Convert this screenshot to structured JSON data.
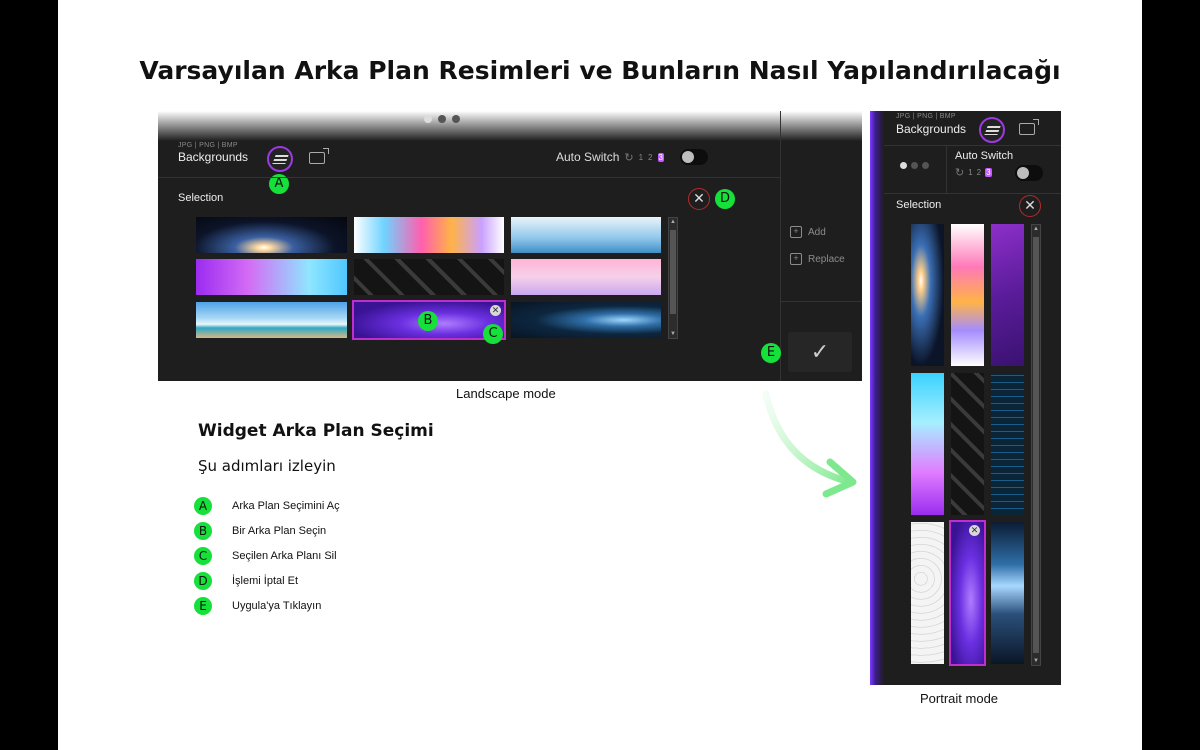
{
  "title": "Varsayılan Arka Plan Resimleri ve Bunların Nasıl Yapılandırılacağı",
  "landscape": {
    "formats": "JPG | PNG | BMP",
    "backgrounds_label": "Backgrounds",
    "auto_switch_label": "Auto Switch",
    "auto_switch_numbers": [
      "1",
      "2",
      "3"
    ],
    "selection_label": "Selection",
    "add_label": "Add",
    "replace_label": "Replace",
    "caption": "Landscape mode"
  },
  "portrait": {
    "formats": "JPG | PNG | BMP",
    "backgrounds_label": "Backgrounds",
    "auto_switch_label": "Auto Switch",
    "auto_switch_numbers": [
      "1",
      "2",
      "3"
    ],
    "selection_label": "Selection",
    "caption": "Portrait mode"
  },
  "markers": {
    "a": "A",
    "b": "B",
    "c": "C",
    "d": "D",
    "e": "E"
  },
  "icons": {
    "close": "✕",
    "remove": "✕",
    "check": "✓",
    "cycle": "↻",
    "up": "▲",
    "down": "▼",
    "plus": "+"
  },
  "instructions": {
    "heading": "Widget Arka Plan Seçimi",
    "subheading": "Şu adımları izleyin",
    "steps": [
      {
        "marker": "A",
        "text": "Arka Plan Seçimini Aç"
      },
      {
        "marker": "B",
        "text": "Bir Arka Plan Seçin"
      },
      {
        "marker": "C",
        "text": "Seçilen Arka Planı Sil"
      },
      {
        "marker": "D",
        "text": "İşlemi İptal Et"
      },
      {
        "marker": "E",
        "text": "Uygula'ya Tıklayın"
      }
    ]
  },
  "colors": {
    "marker_green": "#16e03a",
    "accent_purple": "#c02fcc",
    "close_red": "#b32b2b",
    "panel": "#1e1e1f"
  }
}
